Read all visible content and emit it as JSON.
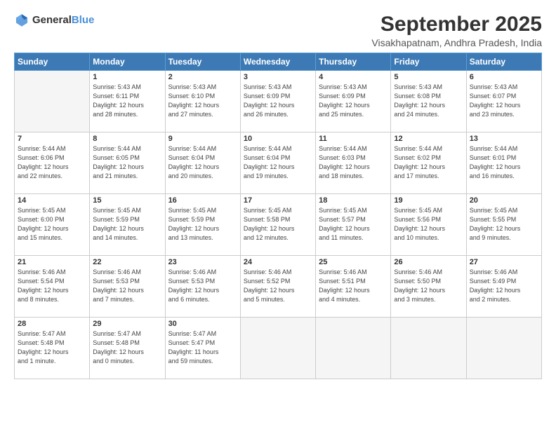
{
  "logo": {
    "general": "General",
    "blue": "Blue"
  },
  "title": "September 2025",
  "location": "Visakhapatnam, Andhra Pradesh, India",
  "headers": [
    "Sunday",
    "Monday",
    "Tuesday",
    "Wednesday",
    "Thursday",
    "Friday",
    "Saturday"
  ],
  "weeks": [
    [
      {
        "day": "",
        "info": ""
      },
      {
        "day": "1",
        "info": "Sunrise: 5:43 AM\nSunset: 6:11 PM\nDaylight: 12 hours\nand 28 minutes."
      },
      {
        "day": "2",
        "info": "Sunrise: 5:43 AM\nSunset: 6:10 PM\nDaylight: 12 hours\nand 27 minutes."
      },
      {
        "day": "3",
        "info": "Sunrise: 5:43 AM\nSunset: 6:09 PM\nDaylight: 12 hours\nand 26 minutes."
      },
      {
        "day": "4",
        "info": "Sunrise: 5:43 AM\nSunset: 6:09 PM\nDaylight: 12 hours\nand 25 minutes."
      },
      {
        "day": "5",
        "info": "Sunrise: 5:43 AM\nSunset: 6:08 PM\nDaylight: 12 hours\nand 24 minutes."
      },
      {
        "day": "6",
        "info": "Sunrise: 5:43 AM\nSunset: 6:07 PM\nDaylight: 12 hours\nand 23 minutes."
      }
    ],
    [
      {
        "day": "7",
        "info": "Sunrise: 5:44 AM\nSunset: 6:06 PM\nDaylight: 12 hours\nand 22 minutes."
      },
      {
        "day": "8",
        "info": "Sunrise: 5:44 AM\nSunset: 6:05 PM\nDaylight: 12 hours\nand 21 minutes."
      },
      {
        "day": "9",
        "info": "Sunrise: 5:44 AM\nSunset: 6:04 PM\nDaylight: 12 hours\nand 20 minutes."
      },
      {
        "day": "10",
        "info": "Sunrise: 5:44 AM\nSunset: 6:04 PM\nDaylight: 12 hours\nand 19 minutes."
      },
      {
        "day": "11",
        "info": "Sunrise: 5:44 AM\nSunset: 6:03 PM\nDaylight: 12 hours\nand 18 minutes."
      },
      {
        "day": "12",
        "info": "Sunrise: 5:44 AM\nSunset: 6:02 PM\nDaylight: 12 hours\nand 17 minutes."
      },
      {
        "day": "13",
        "info": "Sunrise: 5:44 AM\nSunset: 6:01 PM\nDaylight: 12 hours\nand 16 minutes."
      }
    ],
    [
      {
        "day": "14",
        "info": "Sunrise: 5:45 AM\nSunset: 6:00 PM\nDaylight: 12 hours\nand 15 minutes."
      },
      {
        "day": "15",
        "info": "Sunrise: 5:45 AM\nSunset: 5:59 PM\nDaylight: 12 hours\nand 14 minutes."
      },
      {
        "day": "16",
        "info": "Sunrise: 5:45 AM\nSunset: 5:59 PM\nDaylight: 12 hours\nand 13 minutes."
      },
      {
        "day": "17",
        "info": "Sunrise: 5:45 AM\nSunset: 5:58 PM\nDaylight: 12 hours\nand 12 minutes."
      },
      {
        "day": "18",
        "info": "Sunrise: 5:45 AM\nSunset: 5:57 PM\nDaylight: 12 hours\nand 11 minutes."
      },
      {
        "day": "19",
        "info": "Sunrise: 5:45 AM\nSunset: 5:56 PM\nDaylight: 12 hours\nand 10 minutes."
      },
      {
        "day": "20",
        "info": "Sunrise: 5:45 AM\nSunset: 5:55 PM\nDaylight: 12 hours\nand 9 minutes."
      }
    ],
    [
      {
        "day": "21",
        "info": "Sunrise: 5:46 AM\nSunset: 5:54 PM\nDaylight: 12 hours\nand 8 minutes."
      },
      {
        "day": "22",
        "info": "Sunrise: 5:46 AM\nSunset: 5:53 PM\nDaylight: 12 hours\nand 7 minutes."
      },
      {
        "day": "23",
        "info": "Sunrise: 5:46 AM\nSunset: 5:53 PM\nDaylight: 12 hours\nand 6 minutes."
      },
      {
        "day": "24",
        "info": "Sunrise: 5:46 AM\nSunset: 5:52 PM\nDaylight: 12 hours\nand 5 minutes."
      },
      {
        "day": "25",
        "info": "Sunrise: 5:46 AM\nSunset: 5:51 PM\nDaylight: 12 hours\nand 4 minutes."
      },
      {
        "day": "26",
        "info": "Sunrise: 5:46 AM\nSunset: 5:50 PM\nDaylight: 12 hours\nand 3 minutes."
      },
      {
        "day": "27",
        "info": "Sunrise: 5:46 AM\nSunset: 5:49 PM\nDaylight: 12 hours\nand 2 minutes."
      }
    ],
    [
      {
        "day": "28",
        "info": "Sunrise: 5:47 AM\nSunset: 5:48 PM\nDaylight: 12 hours\nand 1 minute."
      },
      {
        "day": "29",
        "info": "Sunrise: 5:47 AM\nSunset: 5:48 PM\nDaylight: 12 hours\nand 0 minutes."
      },
      {
        "day": "30",
        "info": "Sunrise: 5:47 AM\nSunset: 5:47 PM\nDaylight: 11 hours\nand 59 minutes."
      },
      {
        "day": "",
        "info": ""
      },
      {
        "day": "",
        "info": ""
      },
      {
        "day": "",
        "info": ""
      },
      {
        "day": "",
        "info": ""
      }
    ]
  ]
}
